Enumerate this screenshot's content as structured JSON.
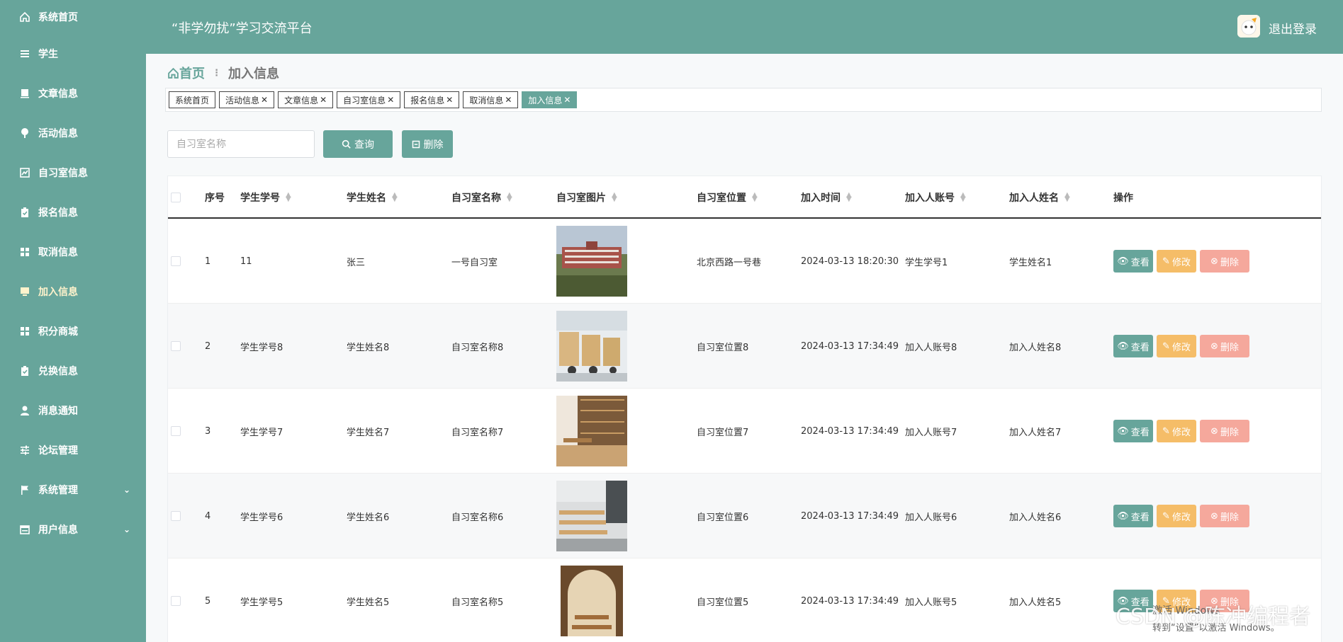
{
  "header": {
    "title": "“非学勿扰”学习交流平台",
    "logout": "退出登录"
  },
  "sidebar": {
    "items": [
      {
        "label": "系统首页",
        "icon": "home-icon"
      },
      {
        "label": "学生",
        "icon": "menu-icon"
      },
      {
        "label": "文章信息",
        "icon": "card-icon"
      },
      {
        "label": "活动信息",
        "icon": "pin-icon"
      },
      {
        "label": "自习室信息",
        "icon": "chart-icon"
      },
      {
        "label": "报名信息",
        "icon": "clipboard-icon"
      },
      {
        "label": "取消信息",
        "icon": "grid-icon"
      },
      {
        "label": "加入信息",
        "icon": "monitor-icon"
      },
      {
        "label": "积分商城",
        "icon": "grid-icon"
      },
      {
        "label": "兑换信息",
        "icon": "clipboard-icon"
      },
      {
        "label": "消息通知",
        "icon": "user-icon"
      },
      {
        "label": "论坛管理",
        "icon": "sliders-icon"
      },
      {
        "label": "系统管理",
        "icon": "flag-icon"
      },
      {
        "label": "用户信息",
        "icon": "window-icon"
      }
    ],
    "active_index": 7,
    "expand_icon": "chevron-down-icon"
  },
  "breadcrumb": {
    "home": "首页",
    "current": "加入信息"
  },
  "tags": [
    {
      "label": "系统首页",
      "closable": false
    },
    {
      "label": "活动信息",
      "closable": true
    },
    {
      "label": "文章信息",
      "closable": true
    },
    {
      "label": "自习室信息",
      "closable": true
    },
    {
      "label": "报名信息",
      "closable": true
    },
    {
      "label": "取消信息",
      "closable": true
    },
    {
      "label": "加入信息",
      "closable": true,
      "active": true
    }
  ],
  "search": {
    "placeholder": "自习室名称",
    "query_label": "查询",
    "delete_label": "删除"
  },
  "table": {
    "headers": {
      "no": "序号",
      "student_id": "学生学号",
      "student_name": "学生姓名",
      "room_name": "自习室名称",
      "room_pic": "自习室图片",
      "room_location": "自习室位置",
      "join_time": "加入时间",
      "joiner_account": "加入人账号",
      "joiner_name": "加入人姓名",
      "ops": "操作"
    },
    "rows": [
      {
        "no": "1",
        "student_id": "11",
        "student_name": "张三",
        "room_name": "一号自习室",
        "room_location": "北京西路一号巷",
        "join_time": "2024-03-13 18:20:30",
        "joiner_account": "学生学号1",
        "joiner_name": "学生姓名1"
      },
      {
        "no": "2",
        "student_id": "学生学号8",
        "student_name": "学生姓名8",
        "room_name": "自习室名称8",
        "room_location": "自习室位置8",
        "join_time": "2024-03-13 17:34:49",
        "joiner_account": "加入人账号8",
        "joiner_name": "加入人姓名8"
      },
      {
        "no": "3",
        "student_id": "学生学号7",
        "student_name": "学生姓名7",
        "room_name": "自习室名称7",
        "room_location": "自习室位置7",
        "join_time": "2024-03-13 17:34:49",
        "joiner_account": "加入人账号7",
        "joiner_name": "加入人姓名7"
      },
      {
        "no": "4",
        "student_id": "学生学号6",
        "student_name": "学生姓名6",
        "room_name": "自习室名称6",
        "room_location": "自习室位置6",
        "join_time": "2024-03-13 17:34:49",
        "joiner_account": "加入人账号6",
        "joiner_name": "加入人姓名6"
      },
      {
        "no": "5",
        "student_id": "学生学号5",
        "student_name": "学生姓名5",
        "room_name": "自习室名称5",
        "room_location": "自习室位置5",
        "join_time": "2024-03-13 17:34:49",
        "joiner_account": "加入人账号5",
        "joiner_name": "加入人姓名5"
      }
    ],
    "ops": {
      "view": "查看",
      "edit": "修改",
      "delete": "删除"
    }
  },
  "overlay": {
    "watermark": "CSDN @陈冲编程者",
    "win_line1": "激活 Windows",
    "win_line2": "转到“设置”以激活 Windows。"
  },
  "colors": {
    "primary": "#67a59b",
    "edit": "#f5bd68",
    "delete": "#f5a89c",
    "active_menu": "#fff3cc"
  }
}
